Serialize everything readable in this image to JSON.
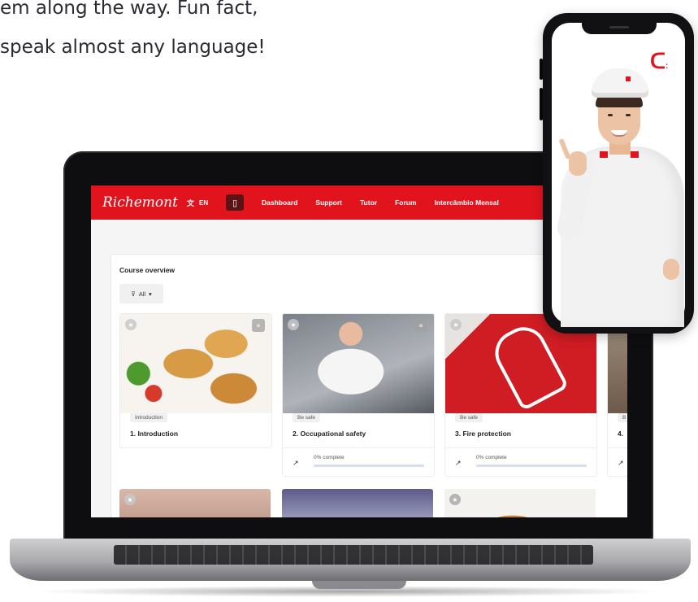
{
  "intro": {
    "line1": "em along the way. Fun fact,",
    "line2": "speak almost any language!"
  },
  "app": {
    "brand": "Richemont",
    "language": {
      "icon": "translate-icon",
      "code": "EN"
    },
    "nav": [
      "Dashboard",
      "Support",
      "Tutor",
      "Forum",
      "Intercâmbio Mensal"
    ],
    "course_overview": "Course overview",
    "filter": {
      "icon": "filter-icon",
      "label": "All",
      "caret": "▾"
    },
    "courses": [
      {
        "category": "Introduction",
        "name": "1. Introduction",
        "image": "pastry-image",
        "progress_text": ""
      },
      {
        "category": "Be safe",
        "name": "2. Occupational safety",
        "image": "chef-image",
        "progress_text": "0% complete",
        "progress": 0
      },
      {
        "category": "Be safe",
        "name": "3. Fire protection",
        "image": "fire-extinguisher-sign-image",
        "progress_text": "0% complete",
        "progress": 0
      },
      {
        "category": "B",
        "name": "4.",
        "image": "partial-image",
        "progress_text": ""
      }
    ]
  },
  "colors": {
    "brand_red": "#e1141e",
    "progress_track": "#d6dcf2",
    "nav_dark": "#5b1316"
  },
  "phone": {
    "logo_icon": "richemont-r-logo-icon"
  }
}
